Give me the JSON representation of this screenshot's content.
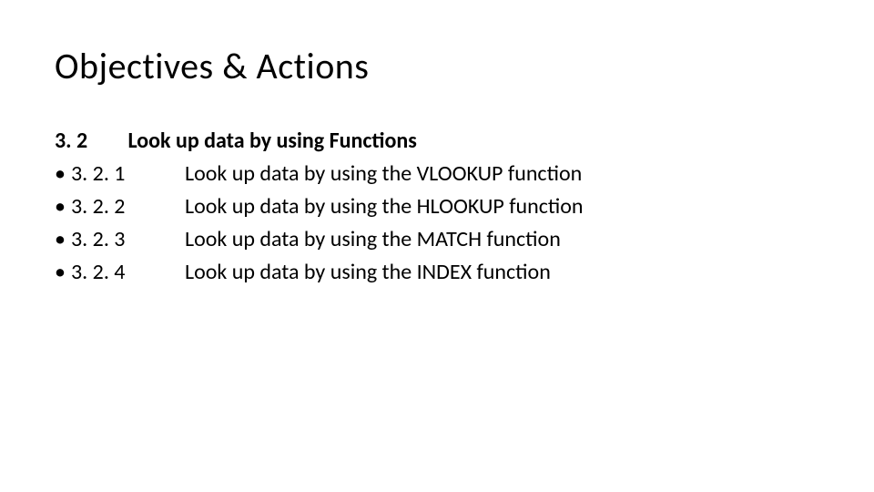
{
  "title": "Objectives & Actions",
  "section": {
    "number": "3. 2",
    "heading": "Look up data by using Functions"
  },
  "items": [
    {
      "bullet": "•",
      "number": "3. 2. 1",
      "text": "Look up data by using the VLOOKUP function"
    },
    {
      "bullet": "•",
      "number": "3. 2. 2",
      "text": "Look up data by using the HLOOKUP function"
    },
    {
      "bullet": "•",
      "number": "3. 2. 3",
      "text": "Look up data by using the MATCH function"
    },
    {
      "bullet": "•",
      "number": "3. 2. 4",
      "text": "Look up data by using the INDEX function"
    }
  ]
}
